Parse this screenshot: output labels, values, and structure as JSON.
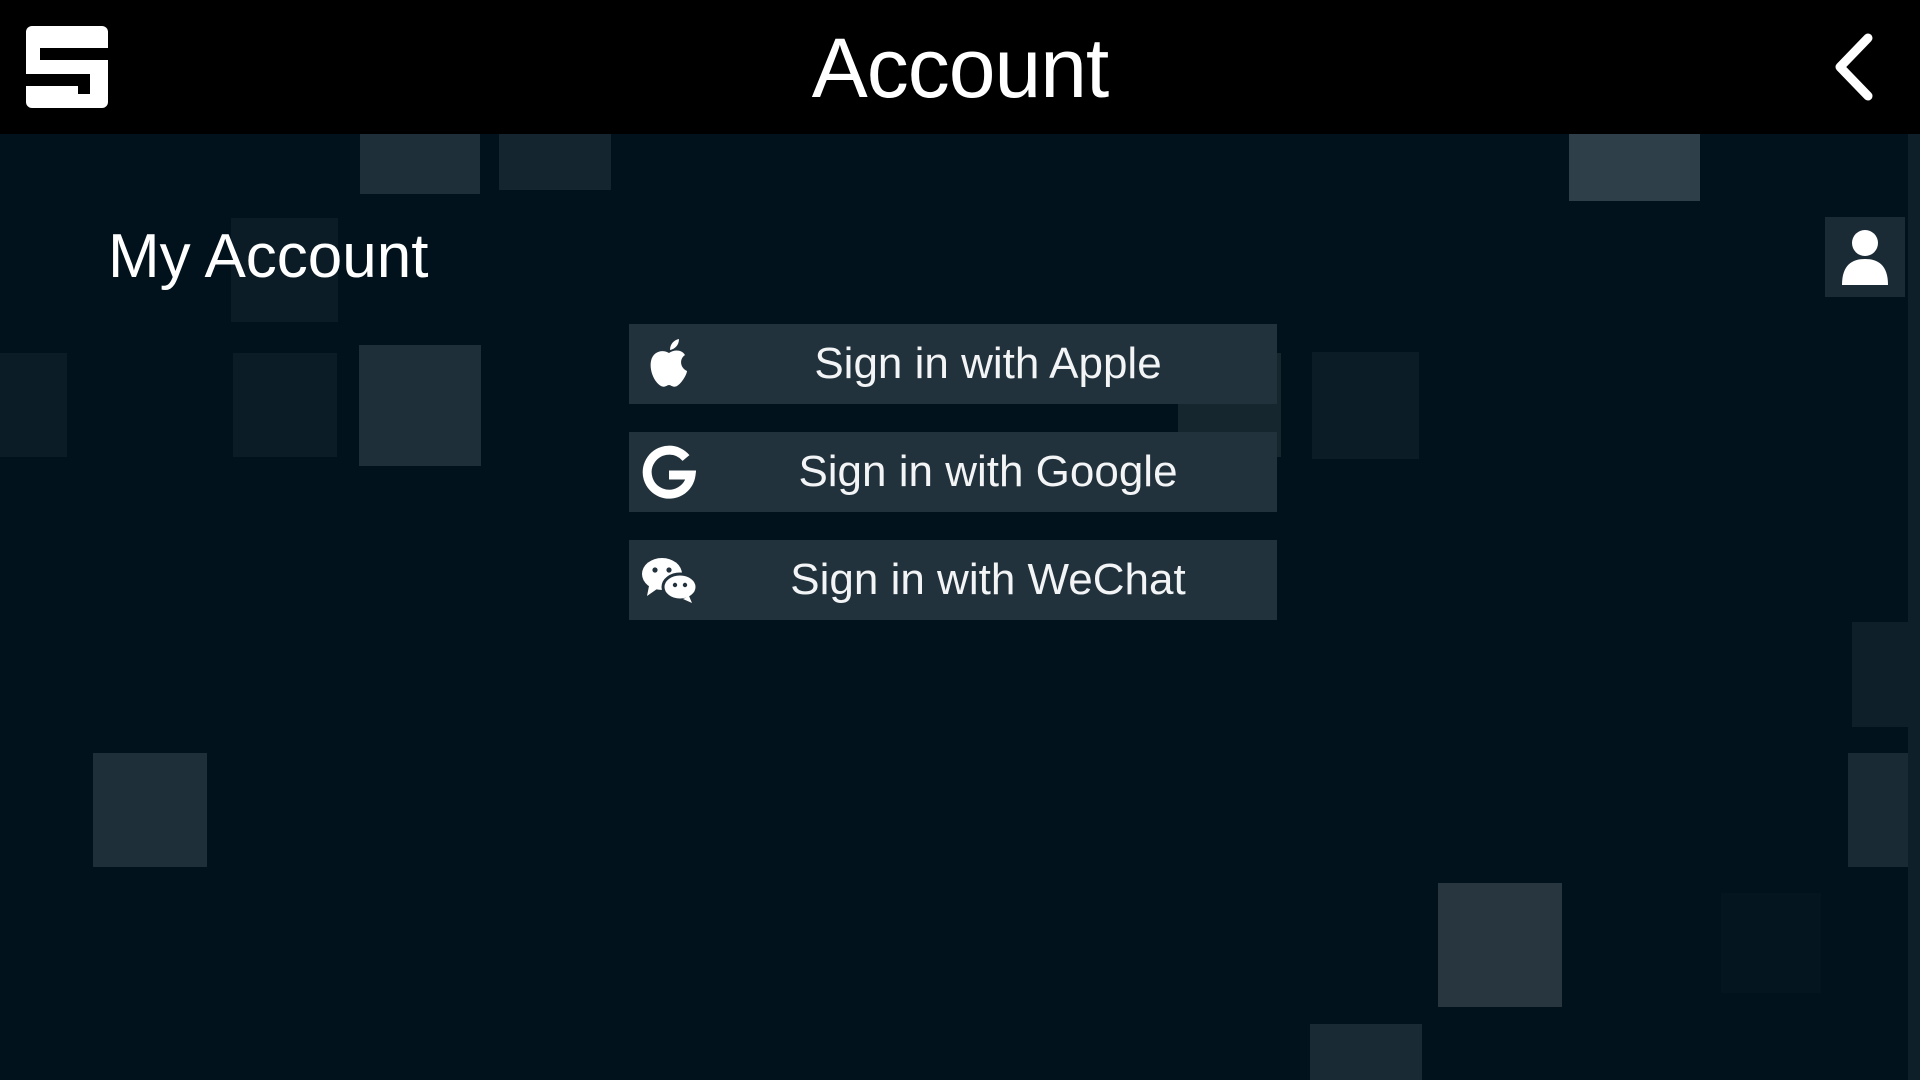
{
  "header": {
    "title": "Account",
    "logo_icon": "app-logo-icon",
    "back_icon": "chevron-left-icon"
  },
  "section": {
    "heading": "My Account",
    "profile_icon": "user-icon"
  },
  "signin": [
    {
      "label": "Sign in with Apple",
      "icon": "apple-icon"
    },
    {
      "label": "Sign in with Google",
      "icon": "google-icon"
    },
    {
      "label": "Sign in with WeChat",
      "icon": "wechat-icon"
    }
  ],
  "colors": {
    "background": "#01121c",
    "topbar": "#000000",
    "button": "#22323c",
    "text": "#ffffff"
  }
}
